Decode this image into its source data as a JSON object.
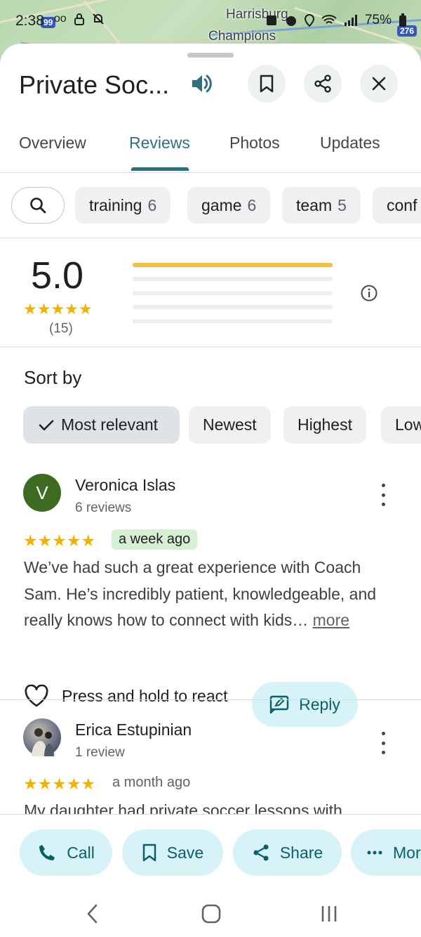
{
  "status_bar": {
    "time": "2:38",
    "battery": "75%"
  },
  "map": {
    "labels": [
      "Harrisburg",
      "Champions"
    ],
    "shields": [
      "99",
      "276"
    ]
  },
  "header": {
    "title": "Private Soc...",
    "icons": [
      "speaker-icon",
      "bookmark-icon",
      "share-icon",
      "close-icon"
    ]
  },
  "tabs": [
    {
      "label": "Overview"
    },
    {
      "label": "Reviews",
      "active": true
    },
    {
      "label": "Photos"
    },
    {
      "label": "Updates"
    }
  ],
  "filter_chips": [
    {
      "label": "training",
      "count": "6"
    },
    {
      "label": "game",
      "count": "6"
    },
    {
      "label": "team",
      "count": "5"
    },
    {
      "label": "conf",
      "count": ""
    }
  ],
  "summary": {
    "rating": "5.0",
    "stars": "★★★★★",
    "count": "(15)",
    "distribution": [
      {
        "stars": 5,
        "fraction": 1.0
      },
      {
        "stars": 4,
        "fraction": 0.0
      },
      {
        "stars": 3,
        "fraction": 0.0
      },
      {
        "stars": 2,
        "fraction": 0.0
      },
      {
        "stars": 1,
        "fraction": 0.0
      }
    ]
  },
  "sort": {
    "label": "Sort by",
    "options": [
      {
        "label": "Most relevant",
        "selected": true
      },
      {
        "label": "Newest"
      },
      {
        "label": "Highest"
      },
      {
        "label": "Low"
      }
    ]
  },
  "reviews": [
    {
      "name": "Veronica Islas",
      "avatar_letter": "V",
      "avatar_color": "#3d6b21",
      "meta": "6 reviews",
      "stars": "★★★★★",
      "time": "a week ago",
      "text": "We’ve had such a great experience with Coach Sam. He’s incredibly patient, knowledgeable, and really knows how to connect with kids…",
      "more": "more",
      "react_label": "Press and hold to react",
      "reply_label": "Reply"
    },
    {
      "name": "Erica Estupinian",
      "meta": "1 review",
      "stars": "★★★★★",
      "time": "a month ago",
      "text": "My daughter had private soccer lessons with"
    }
  ],
  "actions": [
    {
      "label": "Call"
    },
    {
      "label": "Save"
    },
    {
      "label": "Share"
    },
    {
      "label": "Mor"
    }
  ],
  "colors": {
    "accent": "#2f6f7e",
    "star": "#f0b400",
    "action_bg": "#d7f3f7",
    "chip_bg": "#eef0f1"
  }
}
